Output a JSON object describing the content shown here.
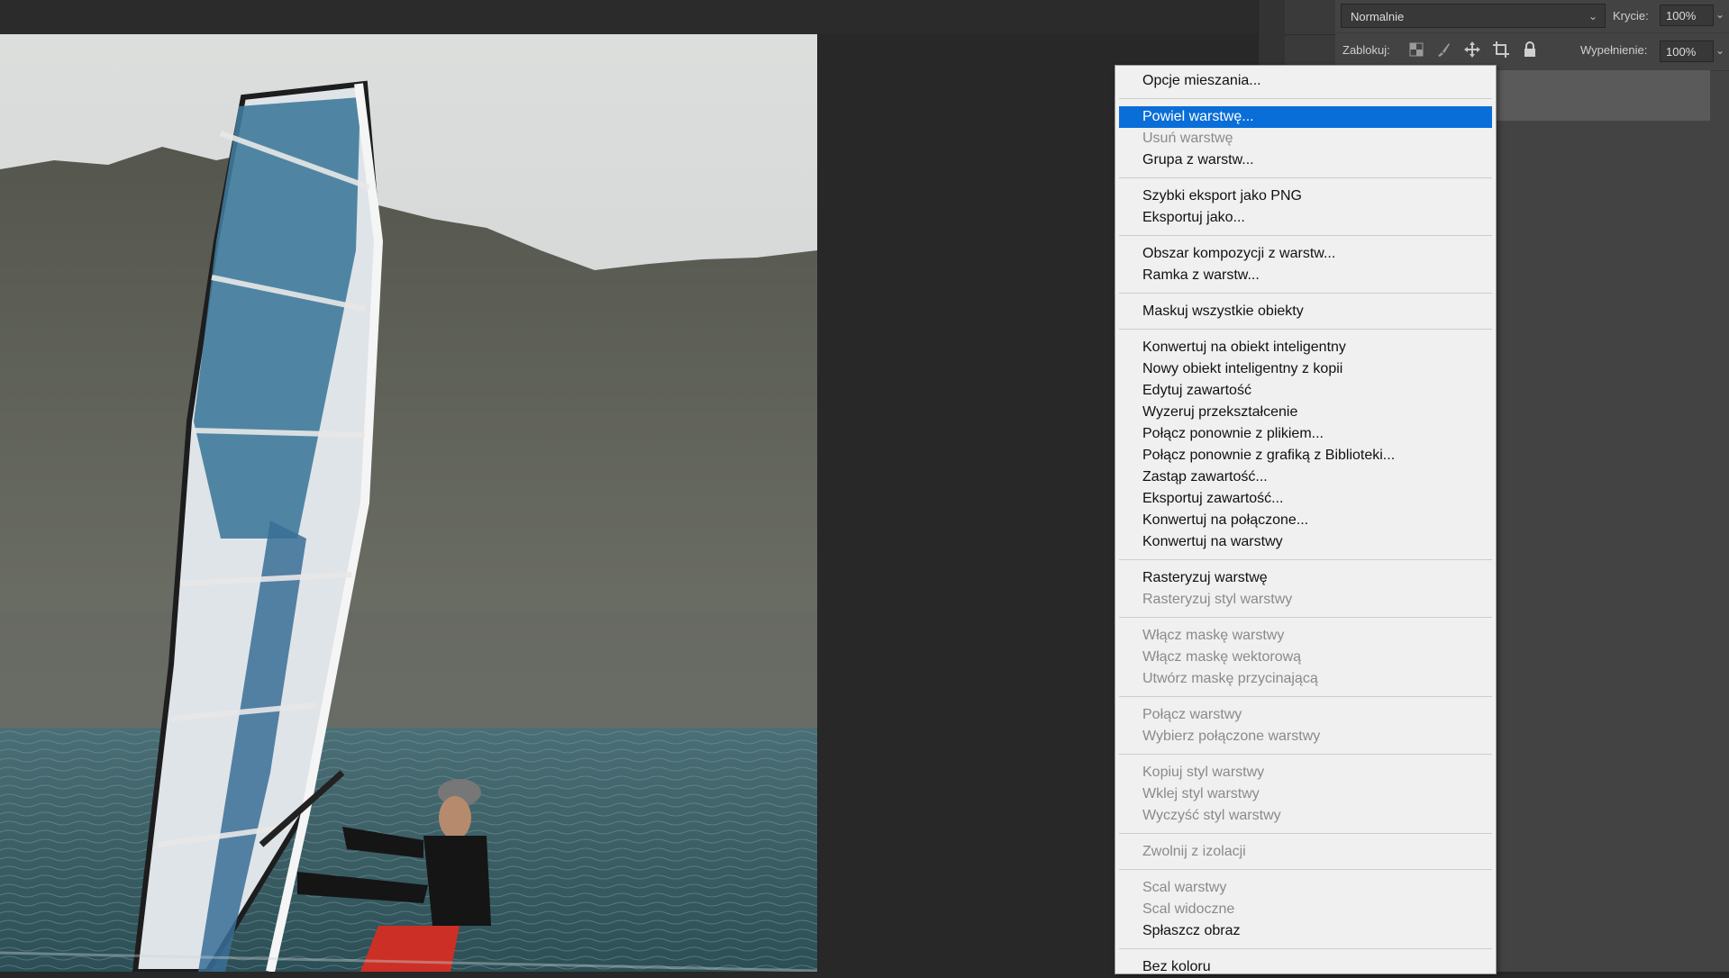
{
  "options_bar": {
    "blend_mode": "Normalnie",
    "opacity_label": "Krycie:",
    "opacity_value": "100%",
    "lock_label": "Zablokuj:",
    "fill_label": "Wypełnienie:",
    "fill_value": "100%"
  },
  "icons": {
    "lock_transparent": "checkerboard-icon",
    "lock_image": "brush-icon",
    "lock_position": "move-icon",
    "lock_artboard": "artboard-icon",
    "lock_all": "lock-icon",
    "dropdown": "chevron-down-icon"
  },
  "colors": {
    "menu_highlight": "#0a6ed8",
    "menu_bg": "#f0f0f0",
    "disabled_text": "#8a8a8a"
  },
  "context_menu": {
    "items": [
      {
        "label": "Opcje mieszania...",
        "state": "enabled"
      },
      {
        "label": "Powiel warstwę...",
        "state": "selected"
      },
      {
        "label": "Usuń warstwę",
        "state": "disabled"
      },
      {
        "label": "Grupa z warstw...",
        "state": "enabled"
      },
      {
        "label": "Szybki eksport jako PNG",
        "state": "enabled"
      },
      {
        "label": "Eksportuj jako...",
        "state": "enabled"
      },
      {
        "label": "Obszar kompozycji z warstw...",
        "state": "enabled"
      },
      {
        "label": "Ramka z warstw...",
        "state": "enabled"
      },
      {
        "label": "Maskuj wszystkie obiekty",
        "state": "enabled"
      },
      {
        "label": "Konwertuj na obiekt inteligentny",
        "state": "enabled"
      },
      {
        "label": "Nowy obiekt inteligentny z kopii",
        "state": "enabled"
      },
      {
        "label": "Edytuj zawartość",
        "state": "enabled"
      },
      {
        "label": "Wyzeruj przekształcenie",
        "state": "enabled"
      },
      {
        "label": "Połącz ponownie z plikiem...",
        "state": "enabled"
      },
      {
        "label": "Połącz ponownie z grafiką z Biblioteki...",
        "state": "enabled"
      },
      {
        "label": "Zastąp zawartość...",
        "state": "enabled"
      },
      {
        "label": "Eksportuj zawartość...",
        "state": "enabled"
      },
      {
        "label": "Konwertuj na połączone...",
        "state": "enabled"
      },
      {
        "label": "Konwertuj na warstwy",
        "state": "enabled"
      },
      {
        "label": "Rasteryzuj warstwę",
        "state": "enabled"
      },
      {
        "label": "Rasteryzuj styl warstwy",
        "state": "disabled"
      },
      {
        "label": "Włącz maskę warstwy",
        "state": "disabled"
      },
      {
        "label": "Włącz maskę wektorową",
        "state": "disabled"
      },
      {
        "label": "Utwórz maskę przycinającą",
        "state": "disabled"
      },
      {
        "label": "Połącz warstwy",
        "state": "disabled"
      },
      {
        "label": "Wybierz połączone warstwy",
        "state": "disabled"
      },
      {
        "label": "Kopiuj styl warstwy",
        "state": "disabled"
      },
      {
        "label": "Wklej styl warstwy",
        "state": "disabled"
      },
      {
        "label": "Wyczyść styl warstwy",
        "state": "disabled"
      },
      {
        "label": "Zwolnij z izolacji",
        "state": "disabled"
      },
      {
        "label": "Scal warstwy",
        "state": "disabled"
      },
      {
        "label": "Scal widoczne",
        "state": "disabled"
      },
      {
        "label": "Spłaszcz obraz",
        "state": "enabled"
      },
      {
        "label": "Bez koloru",
        "state": "enabled"
      }
    ]
  }
}
